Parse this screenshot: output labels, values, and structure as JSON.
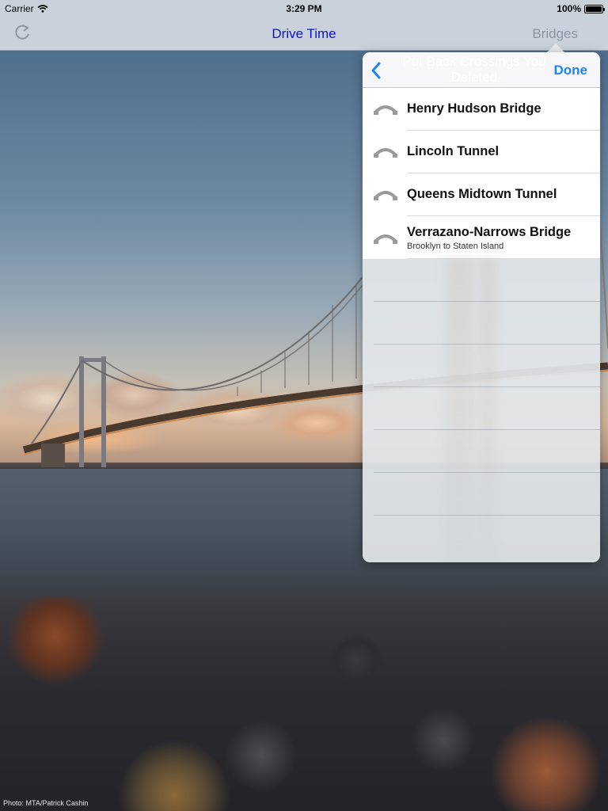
{
  "status_bar": {
    "carrier": "Carrier",
    "time": "3:29 PM",
    "battery": "100%"
  },
  "nav_bar": {
    "title": "Drive Time",
    "right_button": "Bridges",
    "left_icon": "refresh-icon"
  },
  "popover": {
    "back_icon": "chevron-left-icon",
    "title": "Put Back Crossings You Deleted",
    "done_label": "Done",
    "items": [
      {
        "title": "Henry Hudson Bridge",
        "subtitle": ""
      },
      {
        "title": "Lincoln Tunnel",
        "subtitle": ""
      },
      {
        "title": "Queens Midtown Tunnel",
        "subtitle": ""
      },
      {
        "title": "Verrazano-Narrows Bridge",
        "subtitle": "Brooklyn to Staten Island"
      }
    ]
  },
  "photo_credit": "Photo: MTA/Patrick Cashin",
  "colors": {
    "nav_title": "#0a14cf",
    "done": "#1a84ff",
    "bar_background": "#c9d2db"
  }
}
